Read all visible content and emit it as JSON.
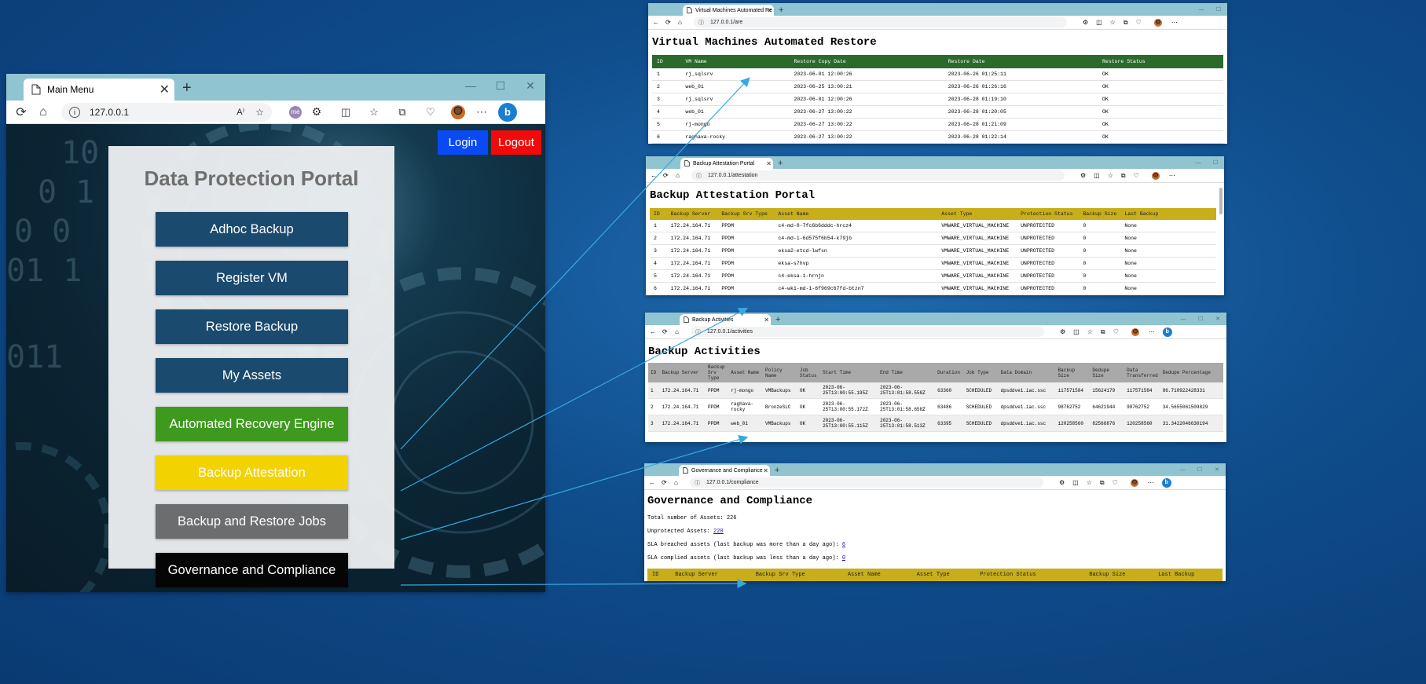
{
  "main": {
    "tab_title": "Main Menu",
    "url": "127.0.0.1",
    "profile_badge": "me",
    "login_label": "Login",
    "logout_label": "Logout",
    "portal_title": "Data Protection Portal",
    "menu": [
      {
        "label": "Adhoc Backup",
        "color": "#1a4a6e"
      },
      {
        "label": "Register VM",
        "color": "#1a4a6e"
      },
      {
        "label": "Restore Backup",
        "color": "#1a4a6e"
      },
      {
        "label": "My Assets",
        "color": "#1a4a6e"
      },
      {
        "label": "Automated Recovery Engine",
        "color": "#3e9a1e"
      },
      {
        "label": "Backup Attestation",
        "color": "#f2d200"
      },
      {
        "label": "Backup and Restore Jobs",
        "color": "#6b6d6e"
      },
      {
        "label": "Governance and Compliance",
        "color": "#050505"
      }
    ],
    "colors": {
      "login": "#0a4af5",
      "logout": "#f00a0a"
    }
  },
  "are": {
    "tab_title": "Virtual Machines Automated Re",
    "url": "127.0.0.1/are",
    "title": "Virtual Machines Automated Restore",
    "header_color": "#2b6a2b",
    "headers": [
      "ID",
      "VM Name",
      "Restore Copy Date",
      "Restore Date",
      "Restore Status"
    ],
    "rows": [
      [
        "1",
        "rj_sqlsrv",
        "2023-06-01 12:00:26",
        "2023-06-26 01:25:11",
        "OK"
      ],
      [
        "2",
        "web_01",
        "2023-06-25 13:00:21",
        "2023-06-26 01:26:16",
        "OK"
      ],
      [
        "3",
        "rj_sqlsrv",
        "2023-06-01 12:00:26",
        "2023-06-28 01:19:10",
        "OK"
      ],
      [
        "4",
        "web_01",
        "2023-06-27 13:00:22",
        "2023-06-28 01:20:05",
        "OK"
      ],
      [
        "5",
        "rj-mongo",
        "2023-06-27 13:00:22",
        "2023-06-28 01:21:09",
        "OK"
      ],
      [
        "6",
        "raghava-rocky",
        "2023-06-27 13:00:22",
        "2023-06-28 01:22:14",
        "OK"
      ]
    ]
  },
  "att": {
    "tab_title": "Backup Attestation Portal",
    "url": "127.0.0.1/attestation",
    "title": "Backup Attestation Portal",
    "header_color": "#c8ae1a",
    "headers": [
      "ID",
      "Backup Server",
      "Backup Srv Type",
      "Asset Name",
      "Asset Type",
      "Protection Status",
      "Backup Size",
      "Last Backup"
    ],
    "rows": [
      [
        "1",
        "172.24.164.71",
        "PPDM",
        "c4-md-0-7fc6b6dddc-hrcz4",
        "VMWARE_VIRTUAL_MACHINE",
        "UNPROTECTED",
        "0",
        "None"
      ],
      [
        "2",
        "172.24.164.71",
        "PPDM",
        "c4-md-1-6d575f6b54-k79jb",
        "VMWARE_VIRTUAL_MACHINE",
        "UNPROTECTED",
        "0",
        "None"
      ],
      [
        "3",
        "172.24.164.71",
        "PPDM",
        "eksa2-etcd-lwfsn",
        "VMWARE_VIRTUAL_MACHINE",
        "UNPROTECTED",
        "0",
        "None"
      ],
      [
        "4",
        "172.24.164.71",
        "PPDM",
        "eksa-s7hvp",
        "VMWARE_VIRTUAL_MACHINE",
        "UNPROTECTED",
        "0",
        "None"
      ],
      [
        "5",
        "172.24.164.71",
        "PPDM",
        "c4-eksa-1-hrnjn",
        "VMWARE_VIRTUAL_MACHINE",
        "UNPROTECTED",
        "0",
        "None"
      ],
      [
        "6",
        "172.24.164.71",
        "PPDM",
        "c4-wk1-md-1-6f969c67fd-btzn7",
        "VMWARE_VIRTUAL_MACHINE",
        "UNPROTECTED",
        "0",
        "None"
      ]
    ]
  },
  "act": {
    "tab_title": "Backup Activities",
    "url": "127.0.0.1/activities",
    "title": "Backup Activities",
    "header_color": "#a9a9a9",
    "headers": [
      "ID",
      "Backup Server",
      "Backup Srv Type",
      "Asset Name",
      "Policy Name",
      "Job Status",
      "Start Time",
      "End Time",
      "Duration",
      "Job Type",
      "Data Domain",
      "Backup Size",
      "Dedupe Size",
      "Data Transferred",
      "Dedupe Percentage"
    ],
    "rows": [
      [
        "1",
        "172.24.164.71",
        "PPDM",
        "rj-mongo",
        "VMBackups",
        "OK",
        "2023-06-25T13:00:55.195Z",
        "2023-06-25T13:01:58.558Z",
        "63360",
        "SCHEDULED",
        "dpsddve1.iac.ssc",
        "117571584",
        "15624179",
        "117571584",
        "86.710922428331"
      ],
      [
        "2",
        "172.24.164.71",
        "PPDM",
        "raghava-rocky",
        "BronzeSLC",
        "OK",
        "2023-06-25T13:00:55.172Z",
        "2023-06-25T13:01:58.658Z",
        "63486",
        "SCHEDULED",
        "dpsddve1.iac.ssc",
        "98762752",
        "64621944",
        "98762752",
        "34.5655061509829"
      ],
      [
        "3",
        "172.24.164.71",
        "PPDM",
        "web_01",
        "VMBackups",
        "OK",
        "2023-06-25T13:00:55.115Z",
        "2023-06-25T13:01:58.513Z",
        "63395",
        "SCHEDULED",
        "dpsddve1.iac.ssc",
        "120258560",
        "82568876",
        "120258560",
        "31.3422046630194"
      ]
    ]
  },
  "gov": {
    "tab_title": "Governance and Compliance",
    "url": "127.0.0.1/compliance",
    "title": "Governance and Compliance",
    "header_color": "#c8ae1a",
    "total_label": "Total number of Assets: 226",
    "unprot_label": "Unprotected Assets:",
    "unprot_value": "220",
    "breach_label": "SLA breached assets (last backup was more than a day ago):",
    "breach_value": "6",
    "complied_label": "SLA complied assets (last backup was less than a day ago):",
    "complied_value": "0",
    "headers": [
      "ID",
      "Backup Server",
      "Backup Srv Type",
      "Asset Name",
      "Asset Type",
      "Protection Status",
      "Backup Size",
      "Last Backup"
    ]
  }
}
